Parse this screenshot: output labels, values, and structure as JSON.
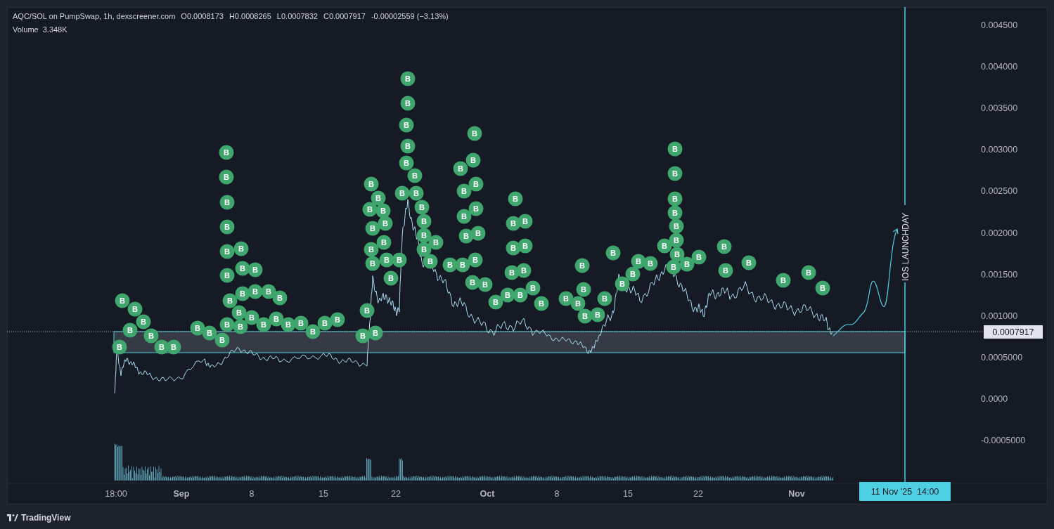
{
  "legend": {
    "symbol": "AQC/SOL on PumpSwap, 1h, dexscreener.com",
    "ohlc": [
      {
        "label": "O",
        "value": "0.0008173"
      },
      {
        "label": "H",
        "value": "0.0008265"
      },
      {
        "label": "L",
        "value": "0.0007832"
      },
      {
        "label": "C",
        "value": "0.0007917"
      }
    ],
    "change": "-0.00002559 (−3.13%)",
    "volume_label": "Volume",
    "volume_value": "3.348K"
  },
  "price_axis": [
    "0.004500",
    "0.004000",
    "0.003500",
    "0.003000",
    "0.002500",
    "0.002000",
    "0.001500",
    "0.001000",
    "0.0005000",
    "0.0000",
    "-0.0005000"
  ],
  "last_price": "0.0007917",
  "time_axis": [
    {
      "label": "18:00",
      "kind": "day"
    },
    {
      "label": "Sep",
      "kind": "month"
    },
    {
      "label": "8",
      "kind": "day"
    },
    {
      "label": "15",
      "kind": "day"
    },
    {
      "label": "22",
      "kind": "day"
    },
    {
      "label": "Oct",
      "kind": "month"
    },
    {
      "label": "8",
      "kind": "day"
    },
    {
      "label": "15",
      "kind": "day"
    },
    {
      "label": "22",
      "kind": "day"
    },
    {
      "label": "Nov",
      "kind": "month"
    }
  ],
  "crosshair_time": "11 Nov '25  14:00",
  "annotation": "IOS LAUNCHDAY",
  "buy_markers": [
    "B",
    "B",
    "B",
    "B",
    "B",
    "B",
    "B",
    "B",
    "B",
    "B",
    "B",
    "B",
    "B",
    "B",
    "B",
    "B",
    "B",
    "B",
    "B",
    "B",
    "B",
    "B",
    "B",
    "B",
    "B",
    "B",
    "B",
    "B",
    "B",
    "B",
    "B",
    "B",
    "B",
    "B",
    "B",
    "B",
    "B",
    "B",
    "B",
    "B",
    "B",
    "B",
    "B",
    "B",
    "B",
    "B",
    "B",
    "B",
    "B",
    "B",
    "B",
    "B",
    "B",
    "B",
    "B",
    "B",
    "B",
    "B",
    "B",
    "B",
    "B",
    "B",
    "B",
    "B",
    "B",
    "B",
    "B",
    "B",
    "B",
    "B",
    "B",
    "B",
    "B",
    "B",
    "B",
    "B",
    "B",
    "B",
    "B",
    "B",
    "B",
    "B",
    "B",
    "B",
    "B",
    "B",
    "B",
    "B",
    "B",
    "B",
    "B",
    "B",
    "B",
    "B",
    "B",
    "B",
    "B",
    "B",
    "B",
    "B",
    "B",
    "B",
    "B",
    "B",
    "B",
    "B",
    "B",
    "B",
    "B",
    "B",
    "B",
    "B",
    "B",
    "B",
    "B",
    "B",
    "B",
    "B",
    "B",
    "B"
  ],
  "footer": "TradingView"
}
